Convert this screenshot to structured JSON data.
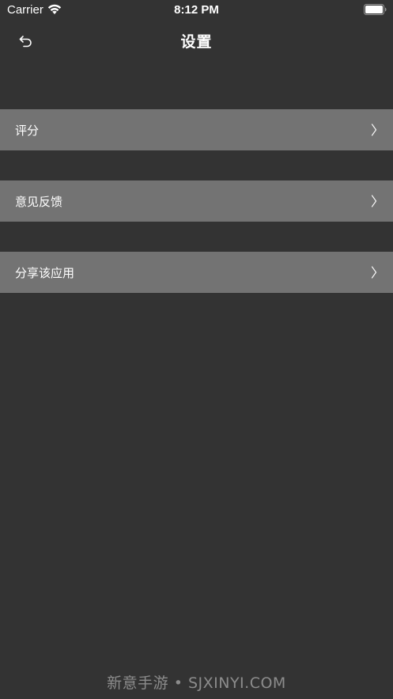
{
  "status_bar": {
    "carrier": "Carrier",
    "time": "8:12 PM",
    "wifi_icon": "wifi-icon",
    "battery_icon": "battery-icon"
  },
  "nav": {
    "back_icon": "back-arrow-icon",
    "title": "设置"
  },
  "settings": {
    "items": [
      {
        "label": "评分",
        "icon": "chevron-right-icon"
      },
      {
        "label": "意见反馈",
        "icon": "chevron-right-icon"
      },
      {
        "label": "分享该应用",
        "icon": "chevron-right-icon"
      }
    ]
  },
  "watermark": {
    "text": "新意手游 • SJXINYI.COM"
  },
  "colors": {
    "background": "#333333",
    "row_background": "#737373",
    "text": "#ffffff",
    "watermark": "#8c8c8c"
  }
}
